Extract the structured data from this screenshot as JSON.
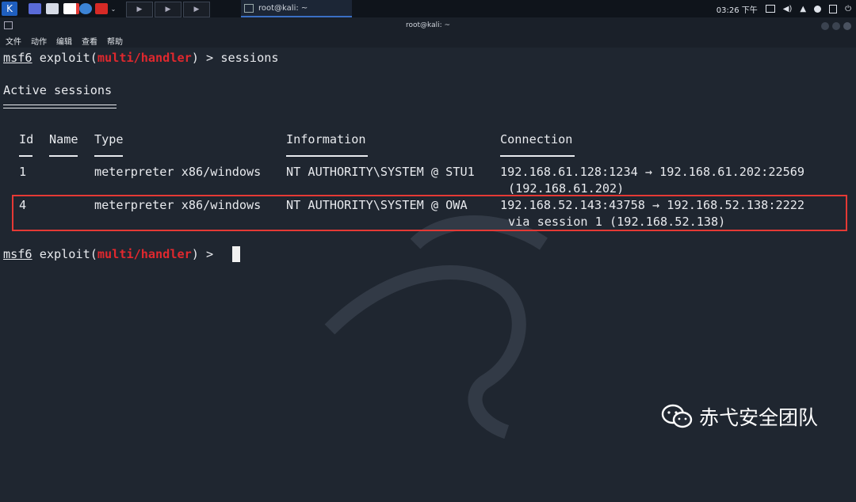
{
  "taskbar": {
    "active_task_label": "root@kali: ~",
    "clock": "03:26 下午",
    "terminal_thumb_glyph": "▶"
  },
  "window": {
    "title": "root@kali: ~",
    "menu": [
      "文件",
      "动作",
      "编辑",
      "查看",
      "帮助"
    ]
  },
  "terminal": {
    "prompt_user": "msf6",
    "prompt_exploit": "exploit(",
    "prompt_module": "multi/handler",
    "prompt_close": ") >",
    "command": " sessions",
    "section_title": "Active sessions",
    "headers": {
      "id": "Id",
      "name": "Name",
      "type": "Type",
      "information": "Information",
      "connection": "Connection"
    },
    "sessions": [
      {
        "id": "1",
        "name": "",
        "type": "meterpreter x86/windows",
        "information": "NT AUTHORITY\\SYSTEM @ STU1",
        "connection_line1": "192.168.61.128:1234 → 192.168.61.202:22569",
        "connection_line2": "(192.168.61.202)"
      },
      {
        "id": "4",
        "name": "",
        "type": "meterpreter x86/windows",
        "information": "NT AUTHORITY\\SYSTEM @ OWA",
        "connection_line1": "192.168.52.143:43758 → 192.168.52.138:2222",
        "connection_line2": "via session 1 (192.168.52.138)"
      }
    ]
  },
  "watermark": {
    "text": "赤弋安全团队",
    "icon": "wechat-icon"
  },
  "colors": {
    "accent_red": "#e0282e",
    "highlight_box": "#e53935"
  }
}
